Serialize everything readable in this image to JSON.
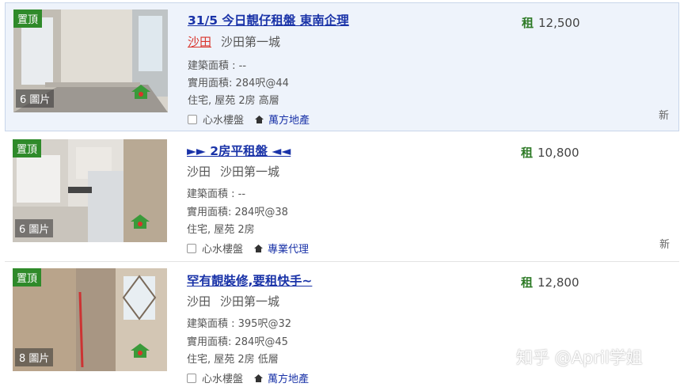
{
  "listings": [
    {
      "badge": "置頂",
      "photo_count": "6 圖片",
      "title": "31/5 今日靚仔租盤 東南企理",
      "district": "沙田",
      "estate": "沙田第一城",
      "gross_area": "建築面積 : --",
      "saleable_area": "實用面積: 284呎@44",
      "details": "住宅, 屋苑 2房 高層",
      "favorite": "心水樓盤",
      "agency": "萬方地產",
      "price_prefix": "租",
      "price": "12,500",
      "new_tag": "新"
    },
    {
      "badge": "置頂",
      "photo_count": "6 圖片",
      "title": "►► 2房平租盤 ◄◄",
      "district": "沙田",
      "estate": "沙田第一城",
      "gross_area": "建築面積 : --",
      "saleable_area": "實用面積: 284呎@38",
      "details": "住宅, 屋苑 2房",
      "favorite": "心水樓盤",
      "agency": "專業代理",
      "price_prefix": "租",
      "price": "10,800",
      "new_tag": "新"
    },
    {
      "badge": "置頂",
      "photo_count": "8 圖片",
      "title": "罕有靚裝修,要租快手~",
      "district": "沙田",
      "estate": "沙田第一城",
      "gross_area": "建築面積 : 395呎@32",
      "saleable_area": "實用面積: 284呎@45",
      "details": "住宅, 屋苑 2房 低層",
      "favorite": "心水樓盤",
      "agency": "萬方地產",
      "price_prefix": "租",
      "price": "12,800"
    }
  ],
  "watermark": "知乎 @April学姐",
  "colors": {
    "title_link": "#1a33a8",
    "badge_bg": "#2f8a2a",
    "price_prefix": "#2d7a26",
    "highlight_bg": "#eef3fb",
    "district_active": "#d9342b"
  }
}
